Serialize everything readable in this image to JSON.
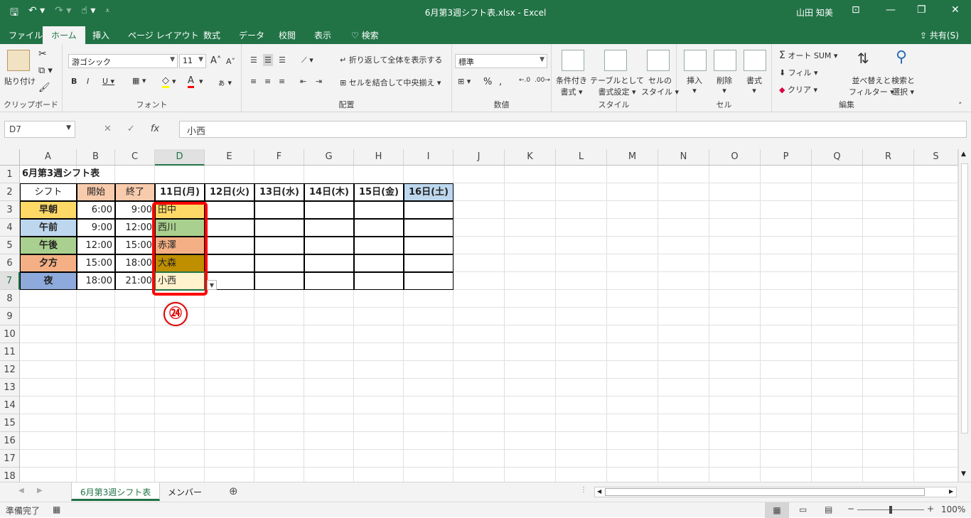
{
  "window": {
    "title": "6月第3週シフト表.xlsx  -  Excel",
    "user": "山田 知美"
  },
  "menu": {
    "file": "ファイル",
    "home": "ホーム",
    "insert": "挿入",
    "layout": "ページ レイアウト",
    "formulas": "数式",
    "data": "データ",
    "review": "校閲",
    "view": "表示",
    "search": "検索",
    "share": "共有(S)"
  },
  "ribbon": {
    "clipboard": {
      "paste": "貼り付け",
      "label": "クリップボード"
    },
    "font": {
      "name": "游ゴシック",
      "size": "11",
      "label": "フォント"
    },
    "align": {
      "wrap": "折り返して全体を表示する",
      "merge": "セルを結合して中央揃え",
      "label": "配置"
    },
    "number": {
      "format": "標準",
      "label": "数値"
    },
    "styles": {
      "cond1": "条件付き",
      "cond2": "書式",
      "table1": "テーブルとして",
      "table2": "書式設定",
      "cell1": "セルの",
      "cell2": "スタイル",
      "label": "スタイル"
    },
    "cells": {
      "insert": "挿入",
      "delete": "削除",
      "format": "書式",
      "label": "セル"
    },
    "edit": {
      "autosum": "オート SUM",
      "fill": "フィル",
      "clear": "クリア",
      "sort1": "並べ替えと",
      "sort2": "フィルター",
      "find1": "検索と",
      "find2": "選択",
      "label": "編集"
    }
  },
  "formula_bar": {
    "namebox": "D7",
    "value": "小西"
  },
  "columns": [
    "A",
    "B",
    "C",
    "D",
    "E",
    "F",
    "G",
    "H",
    "I",
    "J",
    "K",
    "L",
    "M",
    "N",
    "O",
    "P",
    "Q",
    "R",
    "S"
  ],
  "rows": [
    "1",
    "2",
    "3",
    "4",
    "5",
    "6",
    "7",
    "8",
    "9",
    "10",
    "11",
    "12",
    "13",
    "14",
    "15",
    "16",
    "17",
    "18"
  ],
  "sheet": {
    "title": "6月第3週シフト表",
    "headers": [
      "シフト",
      "開始",
      "終了",
      "11日(月)",
      "12日(火)",
      "13日(水)",
      "14日(木)",
      "15日(金)",
      "16日(土)"
    ],
    "shifts": [
      {
        "name": "早朝",
        "start": "6:00",
        "end": "9:00",
        "d11": "田中"
      },
      {
        "name": "午前",
        "start": "9:00",
        "end": "12:00",
        "d11": "西川"
      },
      {
        "name": "午後",
        "start": "12:00",
        "end": "15:00",
        "d11": "赤澤"
      },
      {
        "name": "夕方",
        "start": "15:00",
        "end": "18:00",
        "d11": "大森"
      },
      {
        "name": "夜",
        "start": "18:00",
        "end": "21:00",
        "d11": "小西"
      }
    ]
  },
  "callout": {
    "number": "㉔"
  },
  "tabs": {
    "sheet1": "6月第3週シフト表",
    "sheet2": "メンバー"
  },
  "status": {
    "ready": "準備完了",
    "zoom": "100%"
  },
  "colors": {
    "excel_green": "#217346",
    "early": "#ffd966",
    "morning": "#bdd7ee",
    "afternoon": "#a9d08e",
    "evening": "#f4b084",
    "night": "#8ea9db",
    "tanaka": "#ffd966",
    "nishikawa": "#a9d08e",
    "akazawa": "#f4b084",
    "omori": "#bf8f00",
    "konishi": "#fff2cc"
  }
}
